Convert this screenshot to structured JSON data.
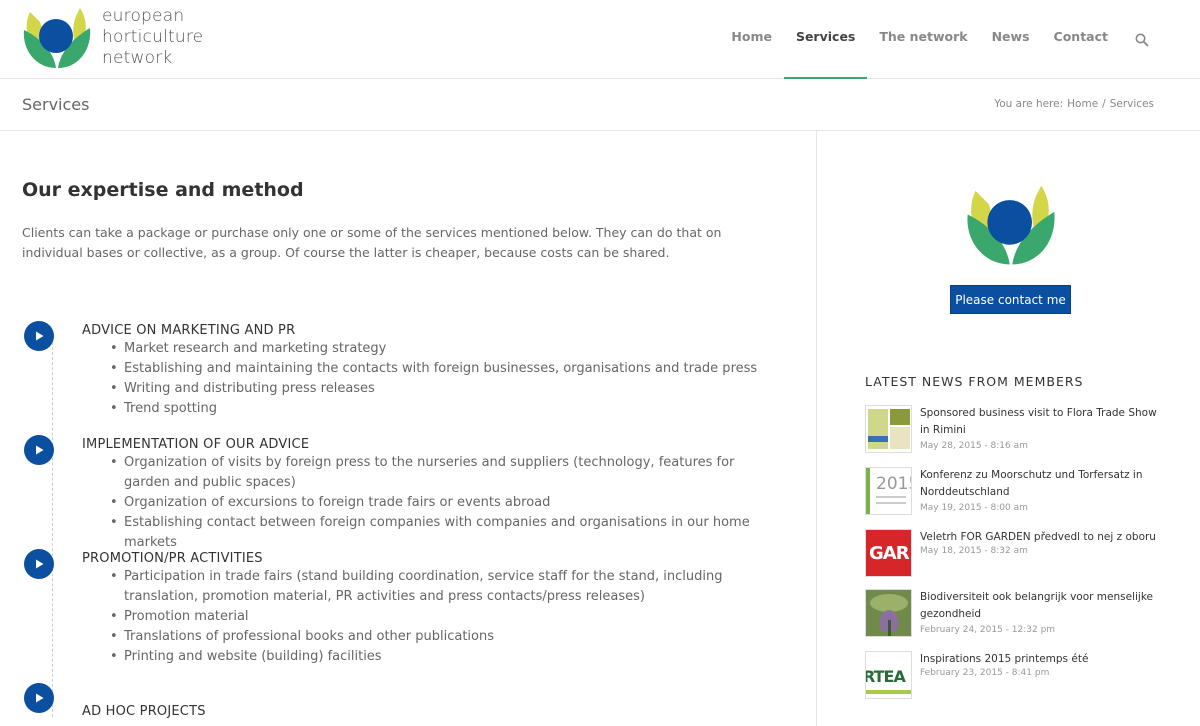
{
  "brand": {
    "name_lines": [
      "european",
      "horticulture",
      "network"
    ],
    "colors": {
      "blue": "#0b4fa0",
      "green": "#3aa76d",
      "yellow": "#d4d64a"
    }
  },
  "nav": {
    "items": [
      {
        "label": "Home",
        "active": false
      },
      {
        "label": "Services",
        "active": true
      },
      {
        "label": "The network",
        "active": false
      },
      {
        "label": "News",
        "active": false
      },
      {
        "label": "Contact",
        "active": false
      }
    ],
    "search_icon": "search-icon"
  },
  "title_bar": {
    "title": "Services",
    "breadcrumb_prefix": "You are here:",
    "breadcrumb_home": "Home",
    "breadcrumb_sep": "/",
    "breadcrumb_current": "Services"
  },
  "main": {
    "heading": "Our expertise and method",
    "intro": "Clients can take a package or purchase only one or some of the services mentioned below. They can do that on individual bases or collective, as a group. Of course the latter is cheaper, because costs can be shared.",
    "sections": [
      {
        "title": "ADVICE ON MARKETING AND PR",
        "items": [
          "Market research and marketing strategy",
          "Establishing and maintaining the contacts with foreign businesses, organisations and trade press",
          "Writing and distributing press releases",
          "Trend spotting"
        ]
      },
      {
        "title": "IMPLEMENTATION OF OUR ADVICE",
        "items": [
          "Organization of visits by foreign press to the nurseries and suppliers (technology, features for garden and public spaces)",
          "Organization of excursions to foreign trade fairs or events abroad",
          "Establishing contact between foreign companies with companies and organisations in our home markets"
        ]
      },
      {
        "title": "PROMOTION/PR ACTIVITIES",
        "items": [
          "Participation in trade fairs (stand building coordination, service staff for the stand, including translation, promotion material, PR activities and press contacts/press releases)",
          "Promotion material",
          "Translations of professional books and other publications",
          "Printing and website (building) facilities"
        ]
      },
      {
        "title": "AD HOC PROJECTS",
        "items": []
      }
    ]
  },
  "sidebar": {
    "contact_button": "Please contact me",
    "news_heading": "LATEST NEWS FROM MEMBERS",
    "news": [
      {
        "title": "Sponsored business visit to Flora Trade Show in Rimini",
        "date": "May 28, 2015 - 8:16 am",
        "thumb": "flora-thumb"
      },
      {
        "title": "Konferenz zu Moorschutz und Torfersatz in Norddeutschland",
        "date": "May 19, 2015 - 8:00 am",
        "thumb": "2015-thumb",
        "thumb_text": "2015"
      },
      {
        "title": "Veletrh FOR GARDEN předvedl to nej z oboru",
        "date": "May 18, 2015 - 8:32 am",
        "thumb": "gar-thumb",
        "thumb_text": "GAR"
      },
      {
        "title": "Biodiversiteit ook belangrijk voor menselijke gezondheid",
        "date": "February 24, 2015 - 12:32 pm",
        "thumb": "plant-thumb"
      },
      {
        "title": "Inspirations 2015 printemps été",
        "date": "February 23, 2015 - 8:41 pm",
        "thumb": "ortea-thumb",
        "thumb_text": "RTEA"
      }
    ]
  }
}
